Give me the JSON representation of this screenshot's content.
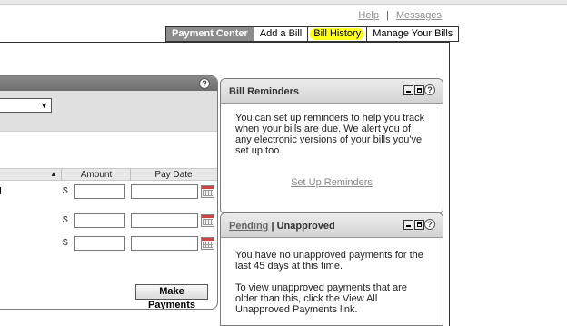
{
  "top_links": {
    "help": "Help",
    "separator": "|",
    "messages": "Messages"
  },
  "tabs": [
    {
      "label": "Payment Center",
      "active": true
    },
    {
      "label": "Add a Bill",
      "active": false
    },
    {
      "label": "Bill History",
      "active": false,
      "highlighted": true
    },
    {
      "label": "Manage Your Bills",
      "active": false
    }
  ],
  "payments_panel": {
    "help_symbol": "?",
    "columns": {
      "amount": "Amount",
      "pay_date": "Pay Date",
      "sort_symbol": "▲"
    },
    "currency_symbol": "$",
    "rows": [
      {
        "amount": "",
        "pay_date": ""
      },
      {
        "amount": "",
        "pay_date": ""
      },
      {
        "amount": "",
        "pay_date": ""
      }
    ],
    "make_payments_label": "Make Payments"
  },
  "bill_reminders": {
    "title": "Bill Reminders",
    "help_symbol": "?",
    "body": "You can set up reminders to help you track when your bills are due. We alert you of any electronic versions of your bills you've set up too.",
    "link": "Set Up Reminders"
  },
  "approvals": {
    "pending_label": "Pending",
    "separator": " | ",
    "unapproved_label": "Unapproved",
    "help_symbol": "?",
    "message_1": "You have no unapproved payments for the last 45 days at this time.",
    "message_2": "To view unapproved payments that are older than this, click the View All Unapproved Payments link."
  },
  "colors": {
    "highlight": "#ffff1a",
    "active_tab": "#8c8c8c",
    "panel_header": "#7a7a7a"
  }
}
